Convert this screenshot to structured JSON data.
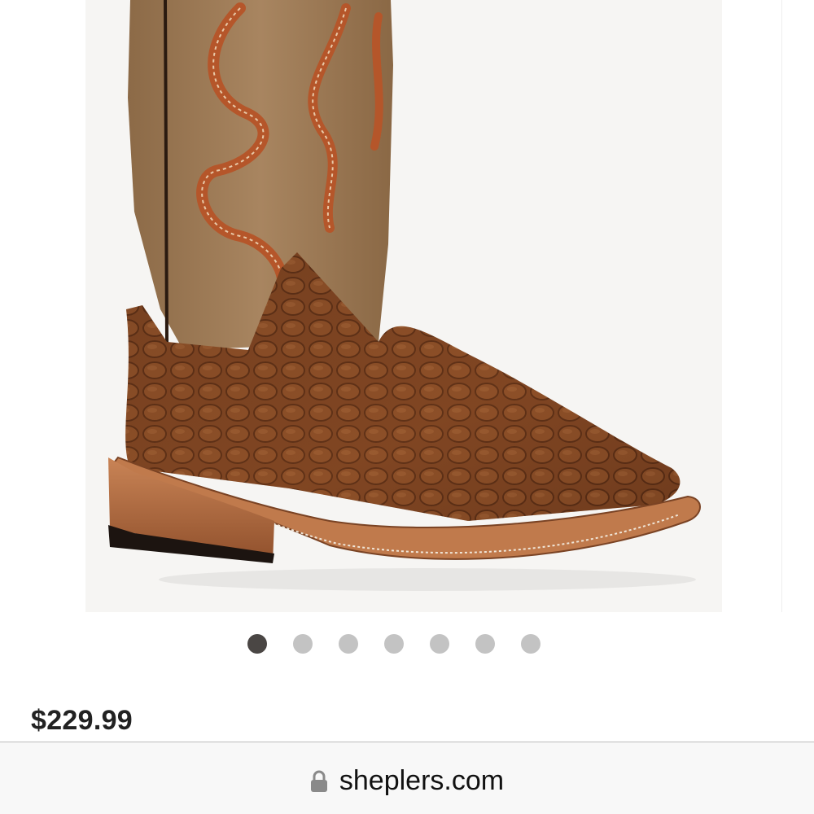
{
  "product": {
    "image_alt": "brown-caiman-print-cowboy-boot",
    "price": "$229.99"
  },
  "carousel": {
    "total": 7,
    "active": 1
  },
  "browser": {
    "url": "sheplers.com",
    "lock_icon": "lock-icon"
  },
  "colors": {
    "dot_active": "#4a4644",
    "dot_inactive": "#c3c3c3"
  }
}
